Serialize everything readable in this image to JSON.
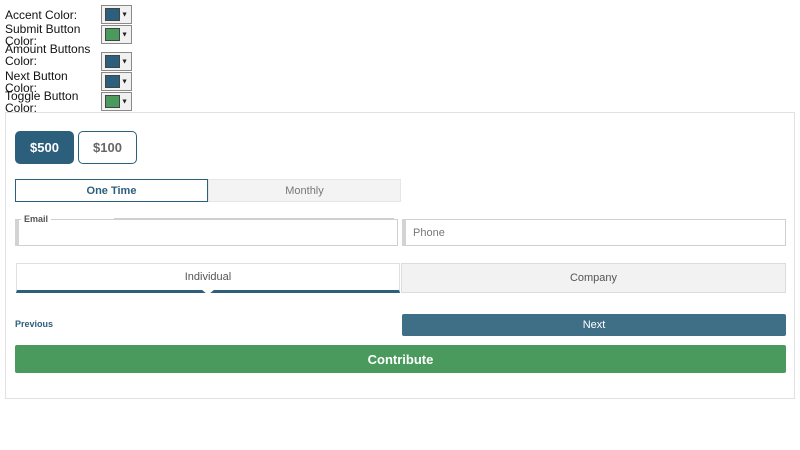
{
  "color_controls": [
    {
      "label": "Accent Color:",
      "value": "#2c5f7c"
    },
    {
      "label": "Submit Button Color:",
      "value": "#4a9a5e"
    },
    {
      "label": "Amount Buttons Color:",
      "value": "#2c5f7c"
    },
    {
      "label": "Next Button Color:",
      "value": "#2c5f7c"
    },
    {
      "label": "Toggle Button Color:",
      "value": "#4a9a5e"
    }
  ],
  "colors": {
    "accent": "#2c5f7c",
    "submit": "#4a9a5e",
    "next": "#3f6f86"
  },
  "form": {
    "amounts": {
      "selected": "$500",
      "other": "$100"
    },
    "frequency": {
      "one_time": "One Time",
      "monthly": "Monthly",
      "selected": "One Time"
    },
    "email": {
      "label": "Email",
      "value": ""
    },
    "phone": {
      "placeholder": "Phone",
      "value": ""
    },
    "donor_type": {
      "individual": "Individual",
      "company": "Company",
      "selected": "Individual"
    },
    "previous_label": "Previous",
    "next_label": "Next",
    "contribute_label": "Contribute"
  },
  "icons": {
    "dropdown": "triangle-down-icon"
  }
}
